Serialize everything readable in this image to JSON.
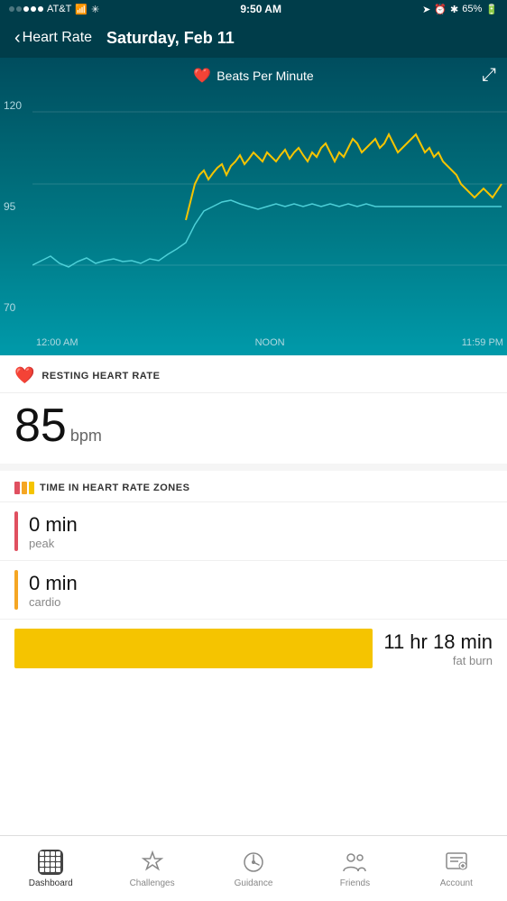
{
  "statusBar": {
    "carrier": "AT&T",
    "time": "9:50 AM",
    "battery": "65%"
  },
  "header": {
    "backLabel": "Heart Rate",
    "title": "Saturday, Feb 11"
  },
  "chart": {
    "legendLabel": "Beats Per Minute",
    "yLabels": [
      "120",
      "95",
      "70"
    ],
    "xLabels": [
      "12:00 AM",
      "NOON",
      "11:59 PM"
    ],
    "expandIcon": "⤢"
  },
  "restingHeartRate": {
    "sectionTitle": "RESTING HEART RATE",
    "value": "85",
    "unit": "bpm"
  },
  "heartRateZones": {
    "sectionTitle": "TIME IN HEART RATE ZONES",
    "zones": [
      {
        "name": "peak",
        "time": "0 min",
        "color": "#e05060"
      },
      {
        "name": "cardio",
        "time": "0 min",
        "color": "#f5a623"
      },
      {
        "name": "fat burn",
        "time": "11 hr 18 min",
        "color": "#f5c400"
      }
    ]
  },
  "tabBar": {
    "items": [
      {
        "label": "Dashboard",
        "active": true
      },
      {
        "label": "Challenges",
        "active": false
      },
      {
        "label": "Guidance",
        "active": false
      },
      {
        "label": "Friends",
        "active": false
      },
      {
        "label": "Account",
        "active": false
      }
    ]
  }
}
